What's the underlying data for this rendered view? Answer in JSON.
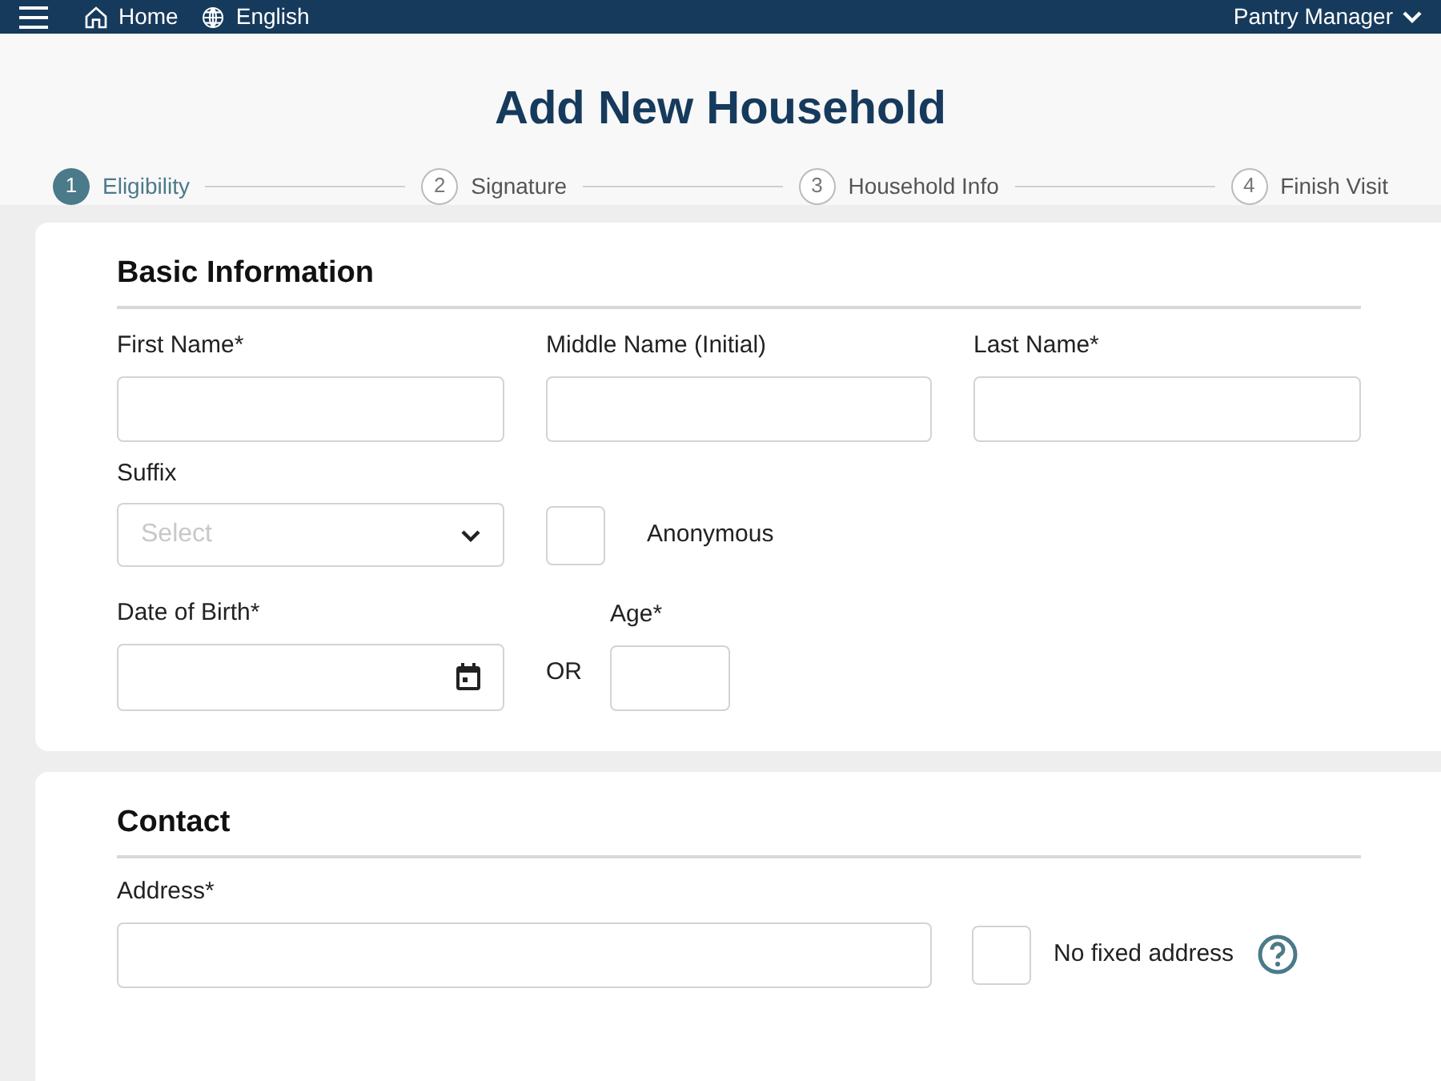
{
  "navbar": {
    "home": "Home",
    "language": "English",
    "user": "Pantry Manager"
  },
  "title": "Add New Household",
  "steps": [
    {
      "number": "1",
      "label": "Eligibility",
      "selected": true
    },
    {
      "number": "2",
      "label": "Signature",
      "selected": false
    },
    {
      "number": "3",
      "label": "Household Info",
      "selected": false
    },
    {
      "number": "4",
      "label": "Finish Visit",
      "selected": false
    }
  ],
  "basic_information": {
    "heading": "Basic Information",
    "first_name": "First Name*",
    "middle_name": "Middle Name (Initial)",
    "last_name": "Last Name*",
    "suffix": {
      "label": "Suffix",
      "placeholder": "Select"
    },
    "anonymous": {
      "label": "Anonymous",
      "checked": false
    },
    "date_of_birth": "Date of Birth*",
    "or": "OR",
    "age": "Age*"
  },
  "contact": {
    "heading": "Contact",
    "address": "Address*",
    "no_fixed_address": {
      "label": "No fixed address",
      "checked": false
    }
  }
}
